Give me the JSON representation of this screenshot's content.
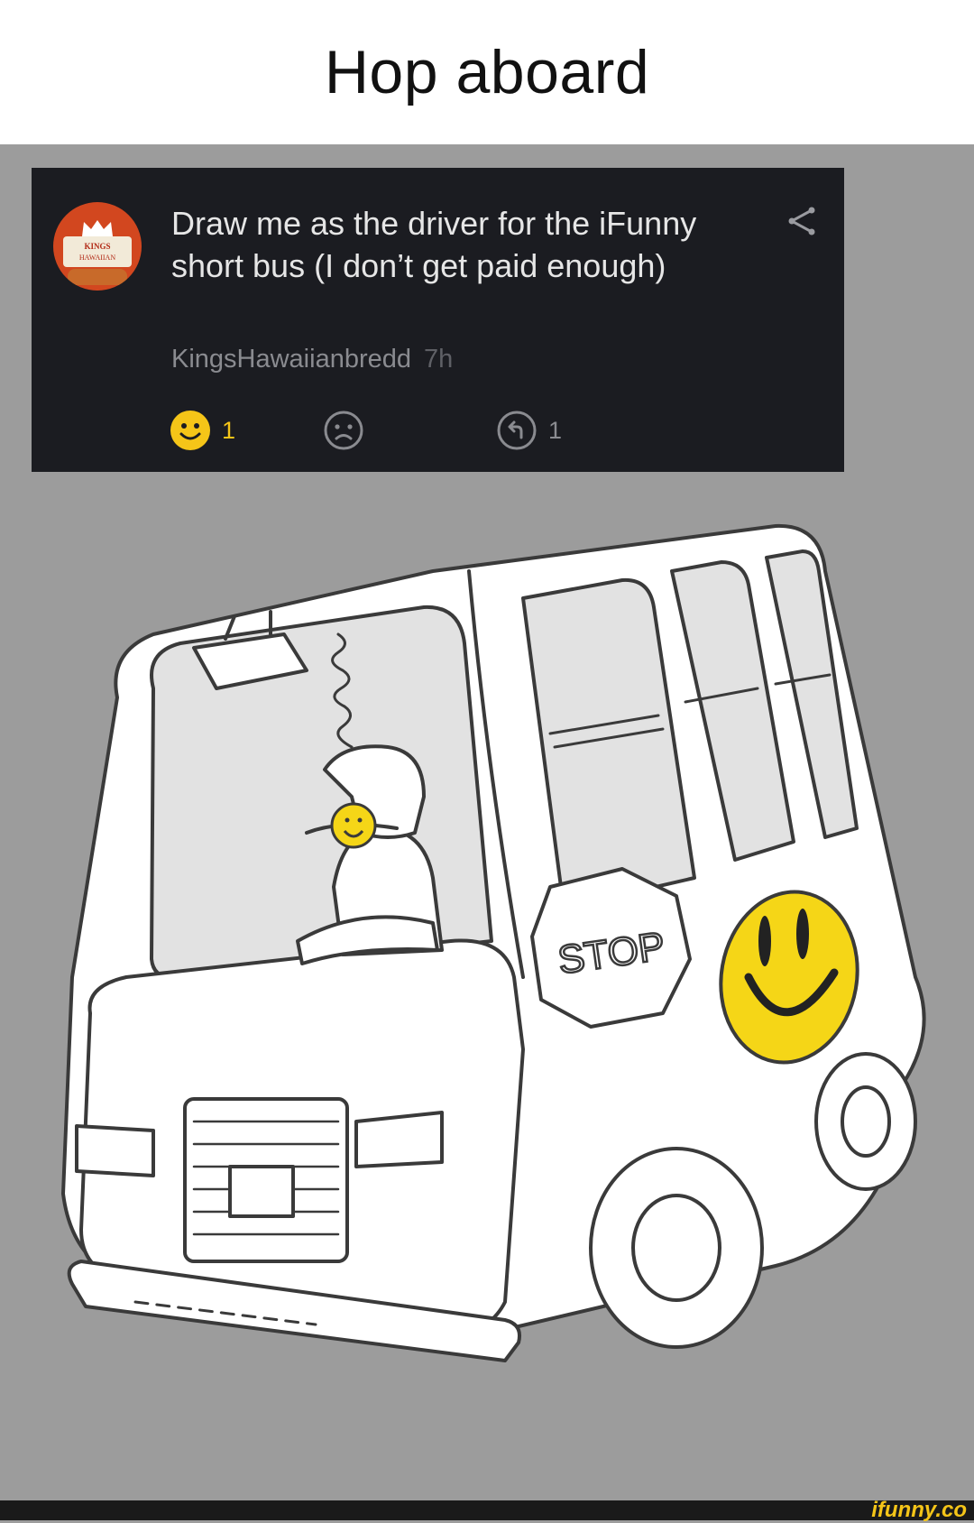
{
  "caption": {
    "text": "Hop aboard"
  },
  "comment": {
    "text": "Draw me as the driver for the iFunny short bus (I don’t get paid enough)",
    "author": "KingsHawaiianbredd",
    "time": "7h",
    "smile_count": "1",
    "reply_count": "1",
    "avatar_brand_lines": [
      "KINGS",
      "HAWAIIAN"
    ]
  },
  "drawing": {
    "sign_text": "STOP"
  },
  "footer": {
    "logo": "ifunny.co"
  },
  "colors": {
    "background": "#9c9c9c",
    "card": "#1b1c21",
    "accent_yellow": "#f5c518",
    "avatar_orange": "#d2471f"
  },
  "icons": [
    "share-icon",
    "smile-icon",
    "sad-face-icon",
    "reply-icon"
  ]
}
